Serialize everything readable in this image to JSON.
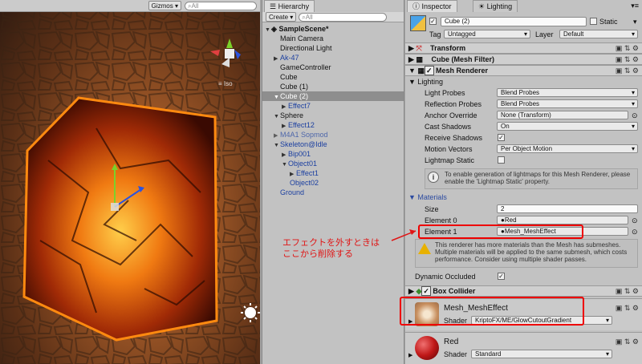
{
  "scene": {
    "gizmos_label": "Gizmos",
    "search_placeholder": "All",
    "iso_label": "Iso"
  },
  "hierarchy": {
    "tab": "Hierarchy",
    "create_label": "Create",
    "search_placeholder": "All",
    "items": [
      {
        "label": "SampleScene*"
      },
      {
        "label": "Main Camera"
      },
      {
        "label": "Directional Light"
      },
      {
        "label": "Ak-47"
      },
      {
        "label": "GameController"
      },
      {
        "label": "Cube"
      },
      {
        "label": "Cube (1)"
      },
      {
        "label": "Cube (2)"
      },
      {
        "label": "Effect7"
      },
      {
        "label": "Sphere"
      },
      {
        "label": "Effect12"
      },
      {
        "label": "M4A1 Sopmod"
      },
      {
        "label": "Skeleton@Idle"
      },
      {
        "label": "Bip001"
      },
      {
        "label": "Object01"
      },
      {
        "label": "Effect1"
      },
      {
        "label": "Object02"
      },
      {
        "label": "Ground"
      }
    ]
  },
  "inspector": {
    "tab_inspector": "Inspector",
    "tab_lighting": "Lighting",
    "object_name": "Cube (2)",
    "static_label": "Static",
    "tag_label": "Tag",
    "tag_value": "Untagged",
    "layer_label": "Layer",
    "layer_value": "Default",
    "components": {
      "transform": "Transform",
      "mesh_filter": "Cube (Mesh Filter)",
      "mesh_renderer": "Mesh Renderer",
      "box_collider": "Box Collider"
    },
    "lighting": {
      "section": "Lighting",
      "light_probes_label": "Light Probes",
      "light_probes_value": "Blend Probes",
      "reflection_probes_label": "Reflection Probes",
      "reflection_probes_value": "Blend Probes",
      "anchor_override_label": "Anchor Override",
      "anchor_override_value": "None (Transform)",
      "cast_shadows_label": "Cast Shadows",
      "cast_shadows_value": "On",
      "receive_shadows_label": "Receive Shadows",
      "motion_vectors_label": "Motion Vectors",
      "motion_vectors_value": "Per Object Motion",
      "lightmap_static_label": "Lightmap Static",
      "lightmap_info": "To enable generation of lightmaps for this Mesh Renderer, please enable the 'Lightmap Static' property."
    },
    "materials": {
      "section": "Materials",
      "size_label": "Size",
      "size_value": "2",
      "element0_label": "Element 0",
      "element0_value": "Red",
      "element1_label": "Element 1",
      "element1_value": "Mesh_MeshEffect",
      "warning": "This renderer has more materials than the Mesh has submeshes. Multiple materials will be applied to the same submesh, which costs performance. Consider using multiple shader passes."
    },
    "dynamic_occluded_label": "Dynamic Occluded",
    "material_cards": [
      {
        "name": "Mesh_MeshEffect",
        "shader_label": "Shader",
        "shader_value": "KriptoFX/ME/GlowCutoutGradient"
      },
      {
        "name": "Red",
        "shader_label": "Shader",
        "shader_value": "Standard"
      }
    ]
  },
  "annotation": {
    "line1": "エフェクトを外すときは",
    "line2": "ここから削除する"
  },
  "colors": {
    "annotation": "#e01515",
    "selection": "#8e8e8e",
    "prefab_blue": "#1b3fa0"
  }
}
